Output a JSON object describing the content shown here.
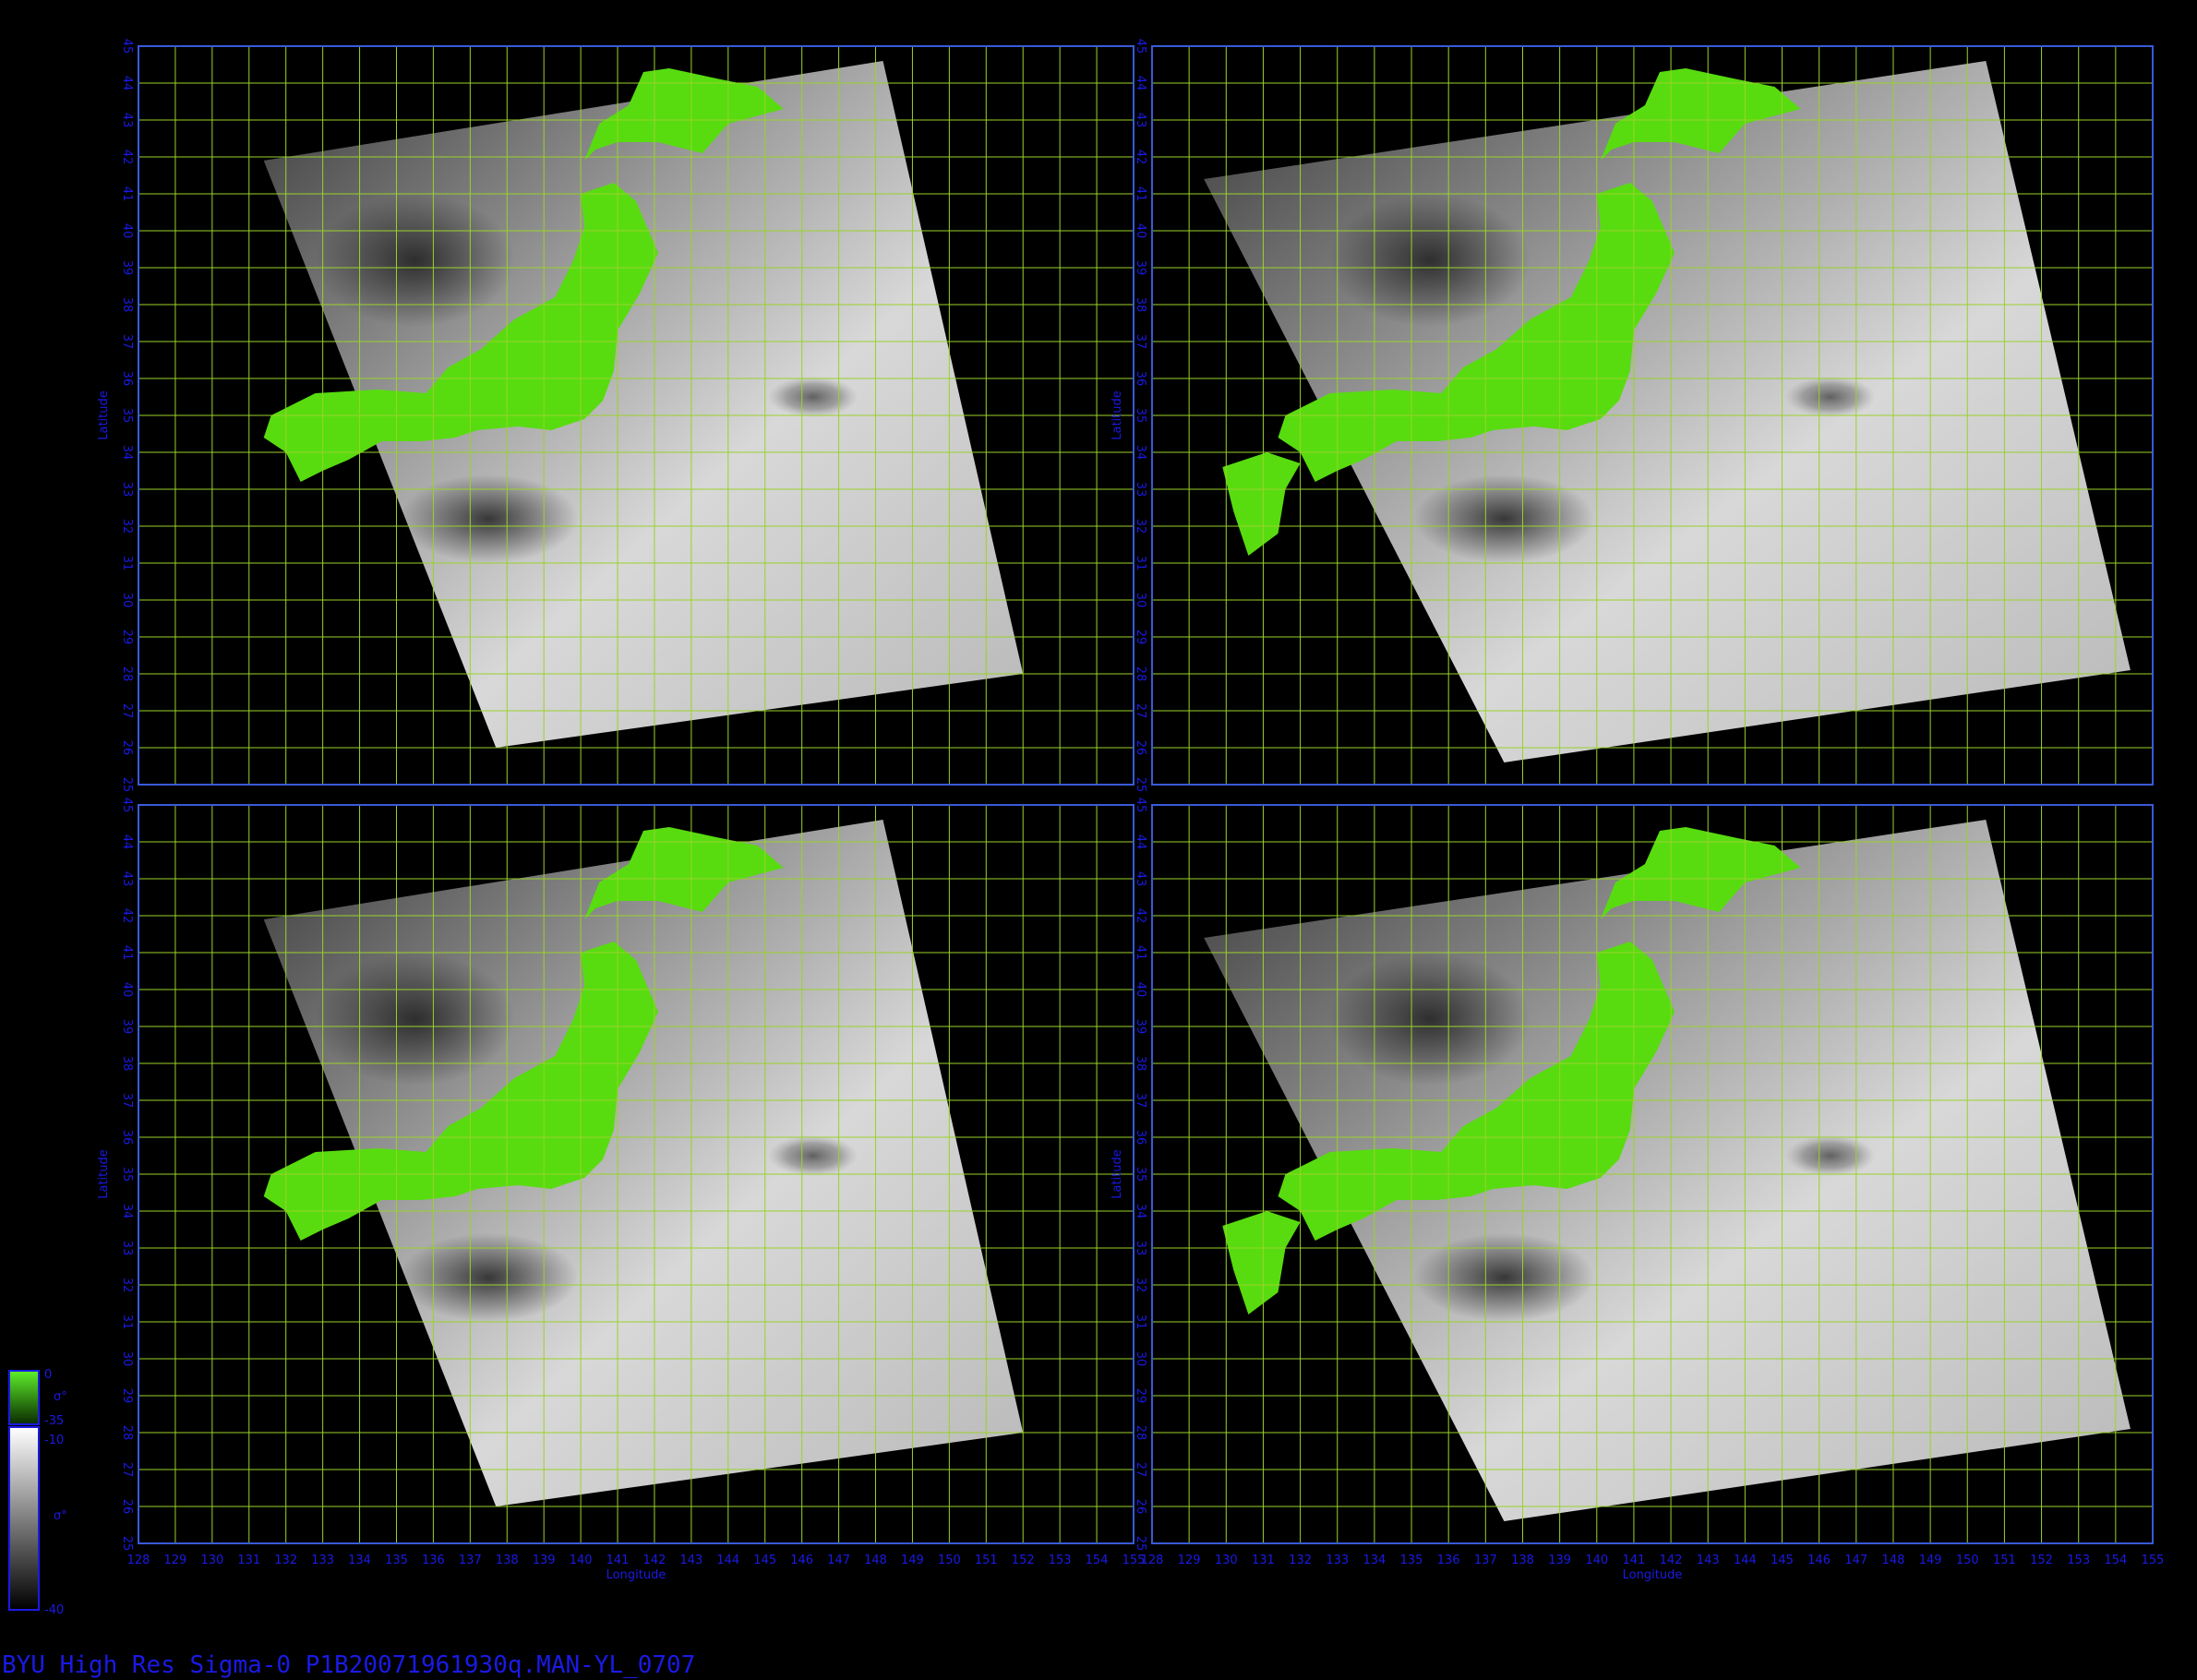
{
  "figure": {
    "caption": "BYU  High  Res  Sigma-0  P1B20071961930q.MAN-YL_0707",
    "xlabel": "Longitude",
    "ylabel": "Latitude"
  },
  "panels": [
    {
      "id": "top-left",
      "lon_range": [
        128,
        155
      ],
      "lat_range": [
        25,
        45
      ]
    },
    {
      "id": "top-right",
      "lon_range": [
        128,
        155
      ],
      "lat_range": [
        25,
        45
      ]
    },
    {
      "id": "bottom-left",
      "lon_range": [
        128,
        155
      ],
      "lat_range": [
        25,
        45
      ]
    },
    {
      "id": "bottom-right",
      "lon_range": [
        128,
        155
      ],
      "lat_range": [
        25,
        45
      ]
    }
  ],
  "lon_ticks": [
    "128",
    "129",
    "130",
    "131",
    "132",
    "133",
    "134",
    "135",
    "136",
    "137",
    "138",
    "139",
    "140",
    "141",
    "142",
    "143",
    "144",
    "145",
    "146",
    "147",
    "148",
    "149",
    "150",
    "151",
    "152",
    "153",
    "154",
    "155"
  ],
  "lat_ticks": [
    "25",
    "26",
    "27",
    "28",
    "29",
    "30",
    "31",
    "32",
    "33",
    "34",
    "35",
    "36",
    "37",
    "38",
    "39",
    "40",
    "41",
    "42",
    "43",
    "44",
    "45"
  ],
  "legend": {
    "land_scale": {
      "top": "0",
      "bottom": "-35",
      "symbol": "σ°",
      "color_top": "#5ef02a",
      "color_bottom": "#0a2a00"
    },
    "ocean_scale": {
      "top": "-10",
      "bottom": "-40",
      "symbol": "σ°",
      "color_top": "#ffffff",
      "color_bottom": "#000000"
    }
  },
  "colors": {
    "background": "#000000",
    "frame": "#3a5ad8",
    "grid": "#9ad22a",
    "land": "#58dc10",
    "label": "#1a1ae6"
  }
}
